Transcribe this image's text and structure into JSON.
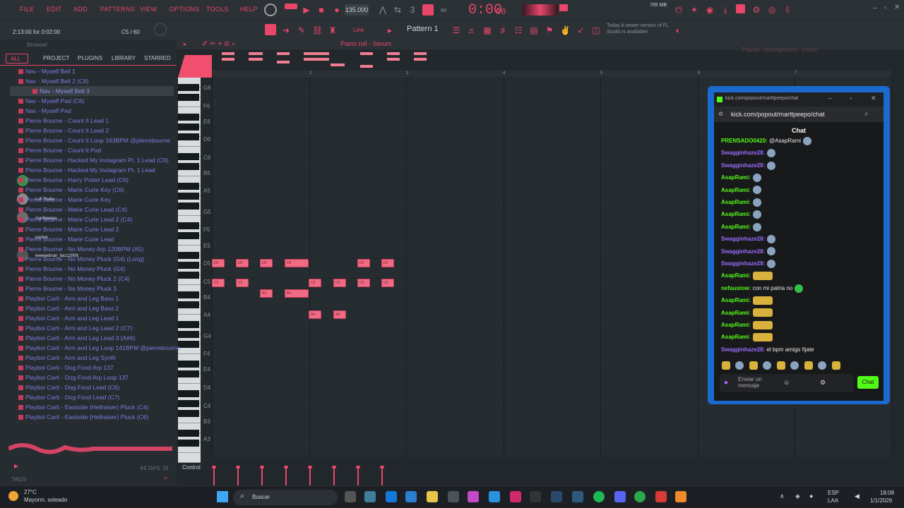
{
  "menu": [
    "FILE",
    "EDIT",
    "ADD",
    "PATTERNS",
    "VIEW",
    "OPTIONS",
    "TOOLS",
    "HELP"
  ],
  "transport": {
    "tempo": "135.000",
    "time": "0:00",
    "time_sub": "00",
    "mem": "765 MB"
  },
  "hint": {
    "position": "2:13:00 for 0:02:00",
    "counter": "C5 / 60"
  },
  "toolbar": {
    "pattern": "Pattern 1",
    "line_mode": "Line",
    "update_notice": "Today  A newer version of FL Studio is available!"
  },
  "piano_roll": {
    "title": "Piano roll - Serum",
    "playlist": "Playlist - Arrangement - (none)",
    "control": "Control"
  },
  "ruler": [
    "2",
    "3",
    "4",
    "5",
    "6",
    "7"
  ],
  "browser": {
    "title": "Browser",
    "tabs": [
      "ALL",
      "PROJECT",
      "PLUGINS",
      "LIBRARY",
      "STARRED"
    ],
    "tags": "TAGS",
    "preview_info": "44.1kHz 16",
    "items": [
      "Nav - Myself Bell 1",
      "Nav - Myself Bell 2 (C6)",
      "Nav - Myself Bell 3",
      "Nav - Myself Pad (C6)",
      "Nav - Myself Pad",
      "Pierre Bourne - Count It Lead 1",
      "Pierre Bourne - Count It Lead 2",
      "Pierre Bourne - Count It Loop 163BPM @pierrebourne",
      "Pierre Bourne - Count It Pad",
      "Pierre Bourne - Hacked My Instagram Pt. 1 Lead (C6)",
      "Pierre Bourne - Hacked My Instagram Pt. 1 Lead",
      "Pierre Bourne - Harry Potter Lead (C6)",
      "Pierre Bourne - Marie Curie Key (C6)",
      "Pierre Bourne - Marie Curie Key",
      "Pierre Bourne - Marie Curie Lead (C4)",
      "Pierre Bourne - Marie Curie Lead 2 (C4)",
      "Pierre Bourne - Marie Curie Lead 2",
      "Pierre Bourne - Marie Curie Lead",
      "Pierre Bourne - No Money Arp 120BPM (A5)",
      "Pierre Bourne - No Money Pluck (G4) (Long)",
      "Pierre Bourne - No Money Pluck (G4)",
      "Pierre Bourne - No Money Pluck 2 (C4)",
      "Pierre Bourne - No Money Pluck 3",
      "Playboi Carti - Arm and Leg Bass 1",
      "Playboi Carti - Arm and Leg Bass 2",
      "Playboi Carti - Arm and Leg Lead 1",
      "Playboi Carti - Arm and Leg Lead 2 (C7)",
      "Playboi Carti - Arm and Leg Lead 3 (A#6)",
      "Playboi Carti - Arm and Leg Loop 141BPM @pierrebourne",
      "Playboi Carti - Arm and Leg Synth",
      "Playboi Carti - Dog Food Arp 137",
      "Playboi Carti - Dog Food Arp Loop 137",
      "Playboi Carti - Dog Food Lead (C6)",
      "Playboi Carti - Dog Food Lead (C7)",
      "Playboi Carti - Eastside (Hellraiser) Pluck (C4)",
      "Playboi Carti - Eastside (Hellraiser) Pluck (C6)"
    ]
  },
  "key_labels": [
    "G6",
    "F6",
    "E6",
    "D6",
    "C6",
    "B5",
    "A5",
    "G5",
    "F5",
    "E5",
    "D5",
    "C5",
    "B4",
    "A4",
    "G4",
    "F4",
    "E4",
    "D4",
    "C4",
    "B3",
    "A3"
  ],
  "notes": [
    {
      "label": "D5"
    },
    {
      "label": "D5"
    },
    {
      "label": "D5"
    },
    {
      "label": "D5"
    },
    {
      "label": "D5"
    },
    {
      "label": "D5"
    },
    {
      "label": "C5"
    },
    {
      "label": "C5"
    },
    {
      "label": "C5"
    },
    {
      "label": "C5"
    },
    {
      "label": "C5"
    },
    {
      "label": "C5"
    },
    {
      "label": "B4"
    },
    {
      "label": "B4"
    },
    {
      "label": "A4"
    },
    {
      "label": "A4"
    }
  ],
  "chat": {
    "window_title": "kick.com/popout/marttpeepo/chat",
    "url": "kick.com/popout/marttpeepo/chat",
    "header": "Chat",
    "input_placeholder": "Enviar un mensaje",
    "send": "Chat",
    "messages": [
      {
        "user": "PRENSADO0420:",
        "text": "@AsapRami",
        "purple": false
      },
      {
        "user": "Swagginhaze28:",
        "text": "",
        "purple": true
      },
      {
        "user": "Swagginhaze28:",
        "text": "",
        "purple": true
      },
      {
        "user": "AsapRami:",
        "text": "",
        "purple": false
      },
      {
        "user": "AsapRami:",
        "text": "",
        "purple": false
      },
      {
        "user": "AsapRami:",
        "text": "",
        "purple": false
      },
      {
        "user": "AsapRami:",
        "text": "",
        "purple": false
      },
      {
        "user": "AsapRami:",
        "text": "",
        "purple": false
      },
      {
        "user": "Swagginhaze28:",
        "text": "",
        "purple": true
      },
      {
        "user": "Swagginhaze28:",
        "text": "",
        "purple": true
      },
      {
        "user": "Swagginhaze28:",
        "text": "",
        "purple": true
      },
      {
        "user": "AsapRami:",
        "text": "",
        "purple": false
      },
      {
        "user": "nefaustow:",
        "text": "con mi patria no",
        "purple": false
      },
      {
        "user": "AsapRami:",
        "text": "",
        "purple": false
      },
      {
        "user": "AsapRami:",
        "text": "",
        "purple": false
      },
      {
        "user": "AsapRami:",
        "text": "",
        "purple": false
      },
      {
        "user": "AsapRami:",
        "text": "",
        "purple": false
      },
      {
        "user": "Swagginhaze28:",
        "text": "el bpm amigo fijate",
        "purple": true
      }
    ]
  },
  "overlay_labels": [
    "Lofi Radio",
    "marttpeepo",
    "packer",
    "eeeeeelnan_bazz2008"
  ],
  "taskbar": {
    "weather_temp": "27°C",
    "weather_desc": "Mayorm. soleado",
    "search": "Buscar",
    "lang": "ESP",
    "lang2": "LAA",
    "time": "18:08",
    "date": "1/1/2026"
  },
  "colors": {
    "accent": "#e8476a",
    "browser_text": "#7c7fe2",
    "kick_green": "#53fc18",
    "chat_frame": "#1b6ad0"
  }
}
